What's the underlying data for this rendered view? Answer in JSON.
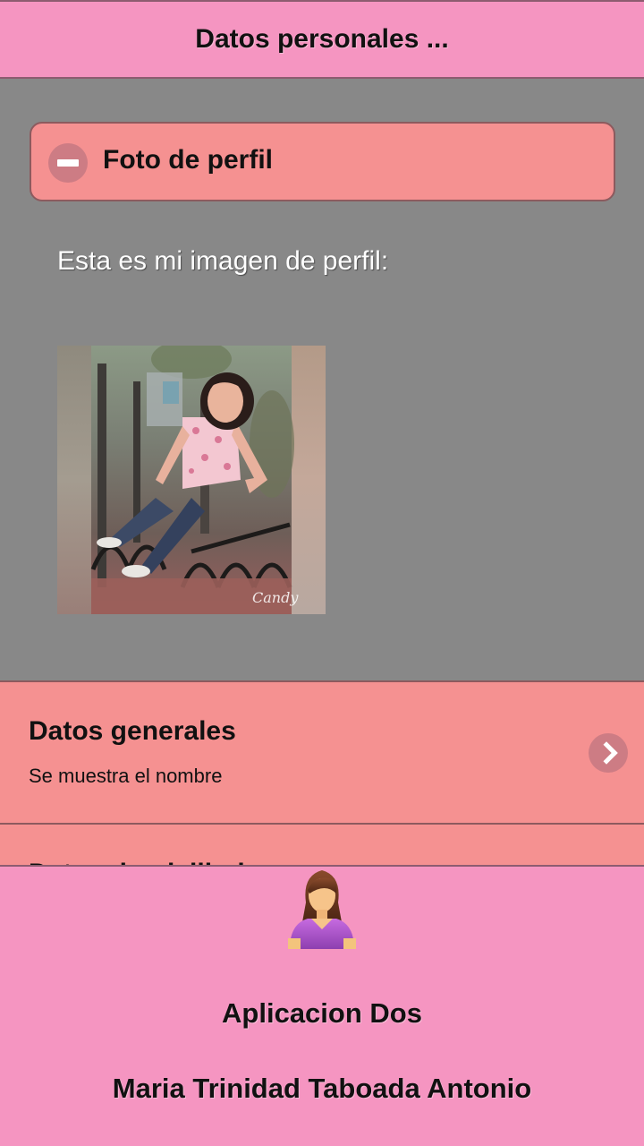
{
  "header": {
    "title": "Datos personales ..."
  },
  "collapsible": {
    "title": "Foto de perfil",
    "icon": "minus-icon",
    "expanded": true
  },
  "profile": {
    "text": "Esta es mi imagen de perfil:",
    "watermark": "Candy"
  },
  "list_items": [
    {
      "title": "Datos generales",
      "subtitle": "Se muestra el nombre",
      "icon": "chevron-right-icon"
    },
    {
      "title": "Datos domiciliarios"
    }
  ],
  "footer": {
    "avatar_icon": "female-user-icon",
    "app_name": "Aplicacion Dos",
    "user_name": "Maria Trinidad Taboada Antonio"
  },
  "colors": {
    "header_bg": "#f595c1",
    "content_bg": "#888888",
    "section_bg": "#f59191",
    "icon_circle": "#cd7c84"
  }
}
